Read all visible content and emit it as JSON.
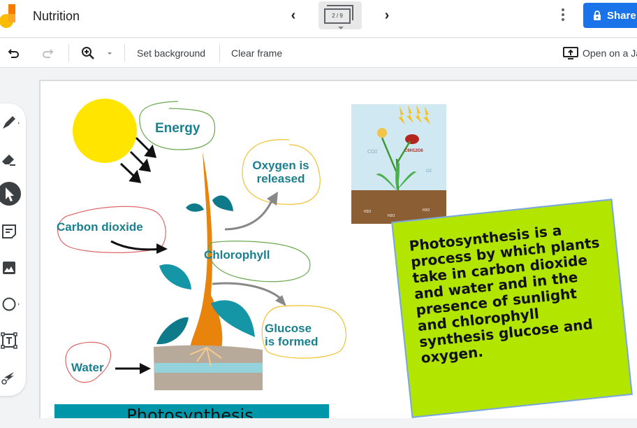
{
  "app": {
    "title": "Nutrition",
    "frame_indicator": "2 / 9",
    "share_label": "Share",
    "brand_color": "#1a73e8"
  },
  "toolbar": {
    "undo": "undo-icon",
    "redo": "redo-icon",
    "zoom": "zoom-in-icon",
    "set_background": "Set background",
    "clear_frame": "Clear frame",
    "open_on_jamboard": "Open on a Jamboard"
  },
  "sidebar": {
    "tools": [
      {
        "name": "pen",
        "icon": "pen-icon"
      },
      {
        "name": "eraser",
        "icon": "eraser-icon"
      },
      {
        "name": "select",
        "icon": "select-arrow-icon",
        "active": true
      },
      {
        "name": "sticky-note",
        "icon": "sticky-note-icon"
      },
      {
        "name": "image",
        "icon": "image-icon"
      },
      {
        "name": "shape",
        "icon": "circle-icon"
      },
      {
        "name": "text-box",
        "icon": "text-box-icon"
      },
      {
        "name": "laser",
        "icon": "laser-icon"
      }
    ]
  },
  "canvas": {
    "diagram_labels": {
      "energy": "Energy",
      "oxygen": "Oxygen is released",
      "oxygen_line1": "Oxygen is",
      "oxygen_line2": "released",
      "carbon_dioxide": "Carbon dioxide",
      "chlorophyll": "Chlorophyll",
      "glucose_line1": "Glucose",
      "glucose_line2": "is formed",
      "water": "Water",
      "banner": "Photosynthesis"
    },
    "small_image_labels": {
      "co2": "CO2",
      "o2": "O2",
      "glucose": "C6H12O6",
      "h2o": "H2O"
    },
    "sticky_note": {
      "text": "Photosynthesis is a process by which plants take in carbon dioxide and water and in the presence of sunlight and chlorophyll synthesis glucose and oxygen.",
      "color": "#b2e600"
    }
  }
}
